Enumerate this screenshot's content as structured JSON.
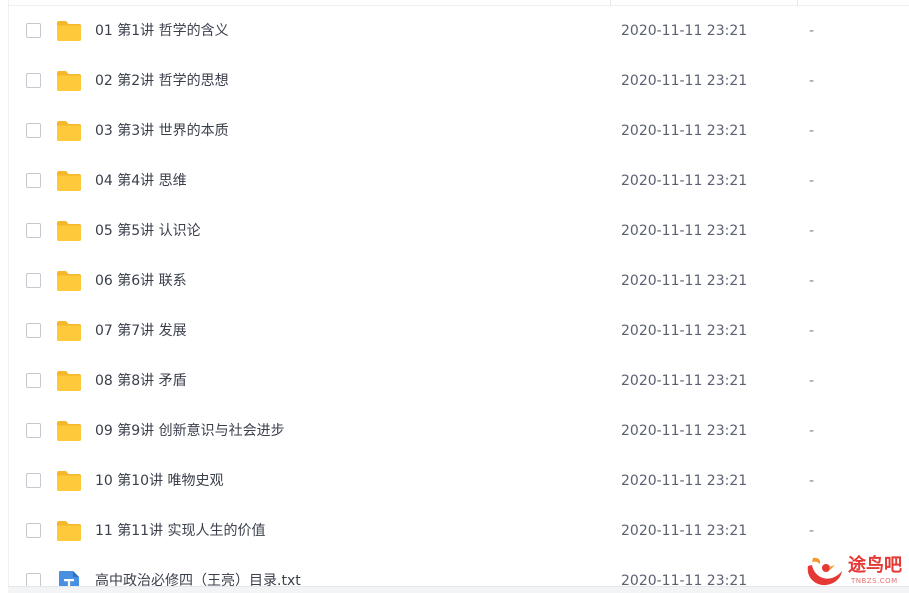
{
  "files": [
    {
      "name": "01 第1讲 哲学的含义",
      "date": "2020-11-11 23:21",
      "size": "-",
      "type": "folder"
    },
    {
      "name": "02 第2讲 哲学的思想",
      "date": "2020-11-11 23:21",
      "size": "-",
      "type": "folder"
    },
    {
      "name": "03 第3讲 世界的本质",
      "date": "2020-11-11 23:21",
      "size": "-",
      "type": "folder"
    },
    {
      "name": "04 第4讲 思维",
      "date": "2020-11-11 23:21",
      "size": "-",
      "type": "folder"
    },
    {
      "name": "05 第5讲 认识论",
      "date": "2020-11-11 23:21",
      "size": "-",
      "type": "folder"
    },
    {
      "name": "06 第6讲 联系",
      "date": "2020-11-11 23:21",
      "size": "-",
      "type": "folder"
    },
    {
      "name": "07 第7讲 发展",
      "date": "2020-11-11 23:21",
      "size": "-",
      "type": "folder"
    },
    {
      "name": "08 第8讲 矛盾",
      "date": "2020-11-11 23:21",
      "size": "-",
      "type": "folder"
    },
    {
      "name": "09 第9讲 创新意识与社会进步",
      "date": "2020-11-11 23:21",
      "size": "-",
      "type": "folder"
    },
    {
      "name": "10 第10讲 唯物史观",
      "date": "2020-11-11 23:21",
      "size": "-",
      "type": "folder"
    },
    {
      "name": "11 第11讲 实现人生的价值",
      "date": "2020-11-11 23:21",
      "size": "-",
      "type": "folder"
    },
    {
      "name": "高中政治必修四（王亮）目录.txt",
      "date": "2020-11-11 23:21",
      "size": "",
      "type": "txt"
    }
  ],
  "icons": {
    "folder": "folder-icon",
    "txt": "txt-file-icon"
  },
  "colors": {
    "folder": "#FFC93C",
    "folder_tab": "#F5B82A",
    "txt_icon": "#4A90E2",
    "watermark": "#E53935"
  },
  "watermark": {
    "text": "途鸟吧",
    "sub": "TNBZS.COM"
  }
}
